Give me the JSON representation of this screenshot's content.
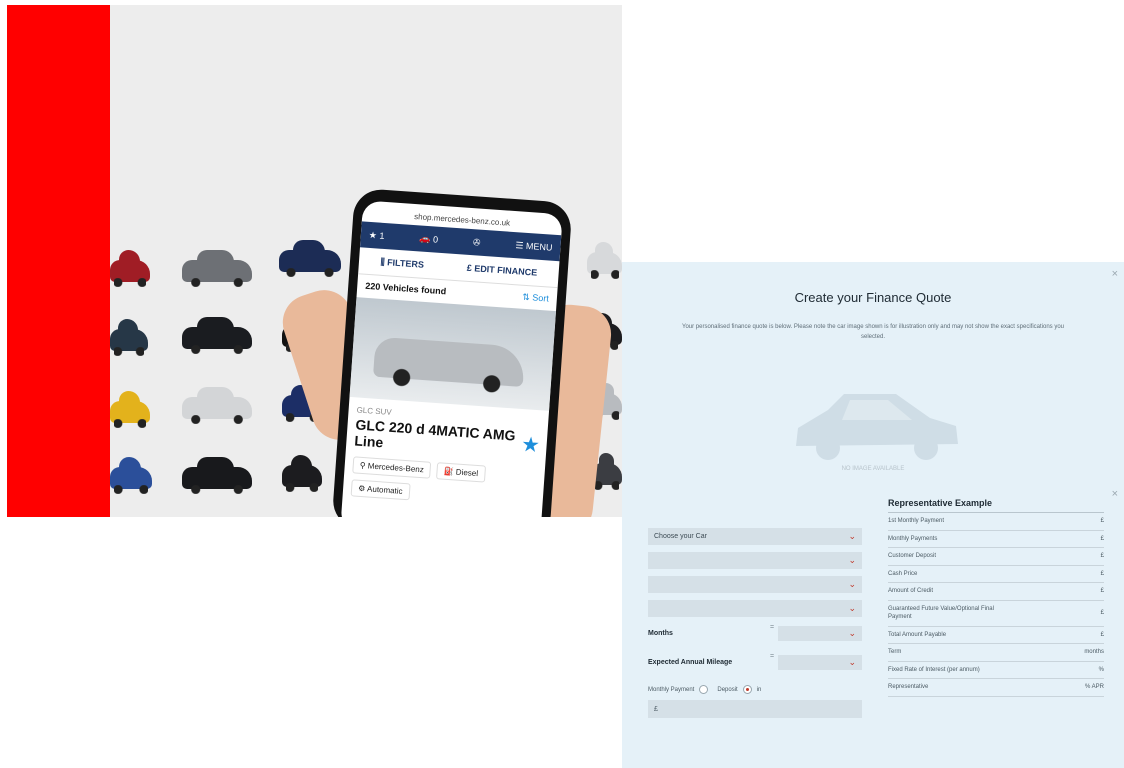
{
  "phone": {
    "url": "shop.mercedes-benz.co.uk",
    "fav_count": "1",
    "garage_count": "0",
    "menu_label": "MENU",
    "filters_label": "FILTERS",
    "edit_finance_label": "EDIT FINANCE",
    "vehicles_found": "220 Vehicles found",
    "sort_label": "Sort",
    "car_category": "GLC SUV",
    "car_model": "GLC 220 d 4MATIC AMG Line",
    "tags": [
      "Mercedes-Benz",
      "Diesel",
      "Automatic"
    ]
  },
  "modal": {
    "title": "Create your Finance Quote",
    "description": "Your personalised finance quote is below. Please note the car image shown is for illustration only and may not show the exact specifications you selected.",
    "no_image": "NO IMAGE AVAILABLE",
    "close_symbol": "×",
    "choose_car": "Choose your Car",
    "months_label": "Months",
    "mileage_label": "Expected Annual Mileage",
    "eq_symbol": "=",
    "monthly_payment_label": "Monthly Payment",
    "deposit_label": "Deposit",
    "in_label": "in",
    "amount_prefix": "£",
    "chevron": "⌄"
  },
  "rep_example": {
    "title": "Representative Example",
    "rows": [
      {
        "label": "1st Monthly Payment",
        "value": "£"
      },
      {
        "label": "Monthly Payments",
        "value": "£"
      },
      {
        "label": "Customer Deposit",
        "value": "£"
      },
      {
        "label": "Cash Price",
        "value": "£"
      },
      {
        "label": "Amount of Credit",
        "value": "£"
      },
      {
        "label": "Guaranteed Future Value/Optional Final Payment",
        "value": "£"
      },
      {
        "label": "Total Amount Payable",
        "value": "£"
      },
      {
        "label": "Term",
        "value": "months"
      },
      {
        "label": "Fixed Rate of Interest (per annum)",
        "value": "%"
      },
      {
        "label": "Representative",
        "value": "% APR"
      }
    ]
  },
  "colors": {
    "accent_red": "#ff0000",
    "modal_bg": "#e5f1f8",
    "brand_blue": "#1f8fdb"
  }
}
